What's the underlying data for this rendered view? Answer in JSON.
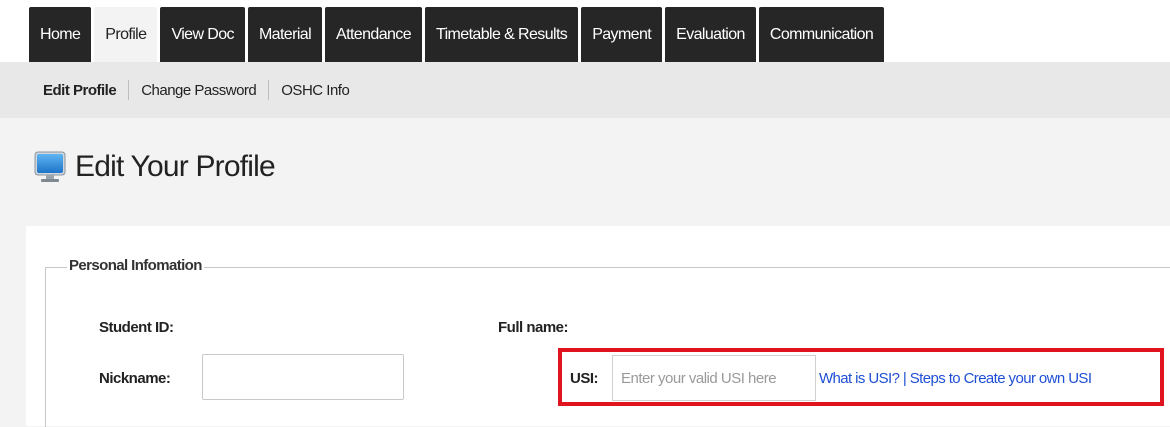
{
  "nav": {
    "tabs": [
      {
        "label": "Home"
      },
      {
        "label": "Profile",
        "active": true
      },
      {
        "label": "View Doc"
      },
      {
        "label": "Material"
      },
      {
        "label": "Attendance"
      },
      {
        "label": "Timetable & Results"
      },
      {
        "label": "Payment"
      },
      {
        "label": "Evaluation"
      },
      {
        "label": "Communication"
      }
    ]
  },
  "subnav": {
    "items": [
      {
        "label": "Edit Profile",
        "active": true
      },
      {
        "label": "Change Password"
      },
      {
        "label": "OSHC Info"
      }
    ]
  },
  "page": {
    "title": "Edit Your Profile",
    "icon": "monitor-icon"
  },
  "form": {
    "section_title": "Personal Infomation",
    "student_id_label": "Student ID:",
    "full_name_label": "Full name:",
    "nickname_label": "Nickname:",
    "nickname_value": "",
    "usi_label": "USI:",
    "usi_placeholder": "Enter your valid USI here",
    "usi_value": "",
    "what_is_usi_link": "What is USI?",
    "link_separator": " | ",
    "steps_link": "Steps to Create your own USI"
  },
  "colors": {
    "tab_bg": "#262626",
    "highlight_border": "#e0141e",
    "link": "#1f4fd6"
  }
}
